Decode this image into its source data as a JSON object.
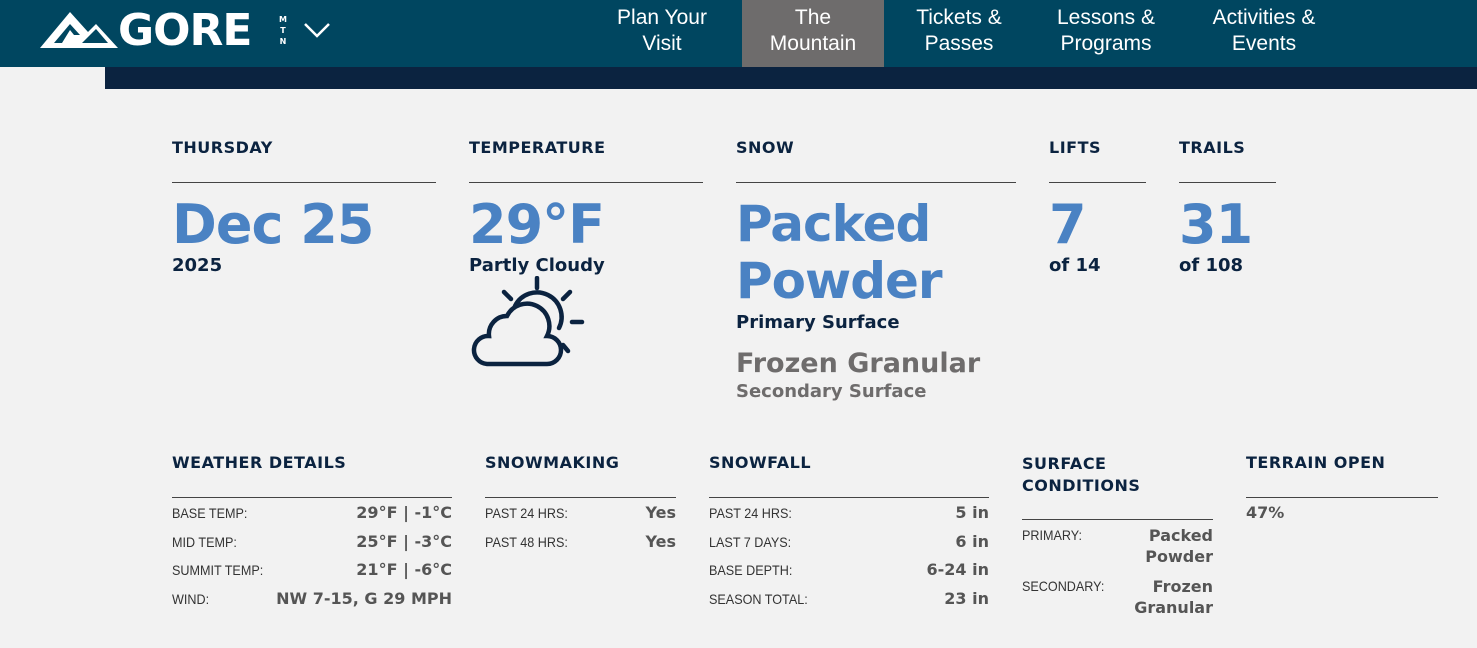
{
  "header": {
    "logo_text": "GORE",
    "logo_sub": [
      "M",
      "T",
      "N"
    ],
    "nav": [
      {
        "line1": "Plan Your",
        "line2": "Visit"
      },
      {
        "line1": "The",
        "line2": "Mountain"
      },
      {
        "line1": "Tickets &",
        "line2": "Passes"
      },
      {
        "line1": "Lessons &",
        "line2": "Programs"
      },
      {
        "line1": "Activities &",
        "line2": "Events"
      }
    ]
  },
  "date": {
    "heading": "THURSDAY",
    "value": "Dec 25",
    "year": "2025"
  },
  "temperature": {
    "heading": "TEMPERATURE",
    "value": "29°F",
    "condition": "Partly Cloudy",
    "icon": "partly-cloudy-icon"
  },
  "snow": {
    "heading": "SNOW",
    "primary_line1": "Packed",
    "primary_line2": "Powder",
    "primary_label": "Primary Surface",
    "secondary": "Frozen Granular",
    "secondary_label": "Secondary Surface"
  },
  "lifts": {
    "heading": "LIFTS",
    "open": "7",
    "total": "of 14"
  },
  "trails": {
    "heading": "TRAILS",
    "open": "31",
    "total": "of 108"
  },
  "weather_details": {
    "heading": "WEATHER DETAILS",
    "rows": [
      {
        "label": "BASE TEMP:",
        "value": "29°F | -1°C"
      },
      {
        "label": "MID TEMP:",
        "value": "25°F | -3°C"
      },
      {
        "label": "SUMMIT TEMP:",
        "value": "21°F | -6°C"
      },
      {
        "label": "WIND:",
        "value": "NW 7-15, G 29 MPH"
      }
    ]
  },
  "snowmaking": {
    "heading": "SNOWMAKING",
    "rows": [
      {
        "label": "PAST 24 HRS:",
        "value": "Yes"
      },
      {
        "label": "PAST 48 HRS:",
        "value": "Yes"
      }
    ]
  },
  "snowfall": {
    "heading": "SNOWFALL",
    "rows": [
      {
        "label": "PAST 24 HRS:",
        "value": "5 in"
      },
      {
        "label": "LAST 7 DAYS:",
        "value": "6 in"
      },
      {
        "label": "BASE DEPTH:",
        "value": "6-24 in"
      },
      {
        "label": "SEASON TOTAL:",
        "value": "23 in"
      }
    ]
  },
  "surface_conditions": {
    "heading_line1": "SURFACE",
    "heading_line2": "CONDITIONS",
    "primary_label": "PRIMARY:",
    "primary_line1": "Packed",
    "primary_line2": "Powder",
    "secondary_label": "SECONDARY:",
    "secondary_line1": "Frozen",
    "secondary_line2": "Granular"
  },
  "terrain": {
    "heading": "TERRAIN OPEN",
    "value": "47%"
  },
  "colors": {
    "header": "#004660",
    "accent": "#4a82c3",
    "navy": "#0b2340",
    "active_nav": "#6e6c6c"
  }
}
